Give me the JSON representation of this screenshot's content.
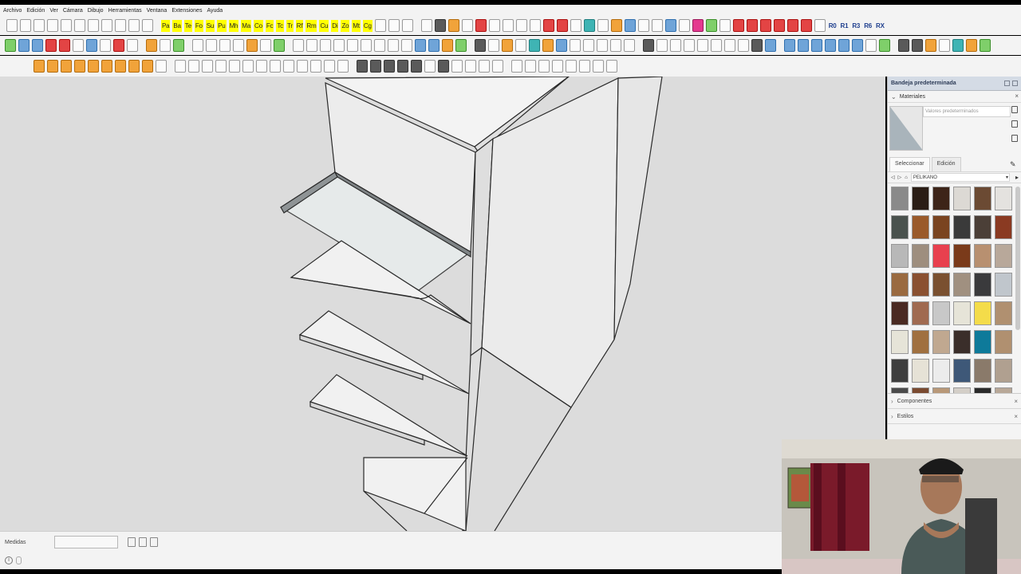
{
  "menubar": {
    "items": [
      "Archivo",
      "Edición",
      "Ver",
      "Cámara",
      "Dibujo",
      "Herramientas",
      "Ventana",
      "Extensiones",
      "Ayuda"
    ]
  },
  "toolbar": {
    "plugin_labels": [
      "Pa",
      "Ba",
      "Te",
      "Fo",
      "Su",
      "Pu",
      "Mh",
      "Ma",
      "Co",
      "Fc",
      "Tc",
      "Tr",
      "Rf",
      "Rm",
      "Cu",
      "Di",
      "Zo",
      "Mt",
      "Cg"
    ],
    "rotation_labels": [
      "R0",
      "R1",
      "R3",
      "R6",
      "RX"
    ]
  },
  "status": {
    "measure_label": "Medidas",
    "measure_value": ""
  },
  "tray": {
    "title": "Bandeja predeterminada",
    "materials_label": "Materiales",
    "material_name_placeholder": "Valores predeterminados",
    "tab_select": "Seleccionar",
    "tab_edit": "Edición",
    "library": "PELIKANO",
    "components_label": "Componentes",
    "styles_label": "Estilos",
    "swatches": [
      "#8a8a8a",
      "#2a1d15",
      "#3d2418",
      "#dcd9d4",
      "#6b4a33",
      "#e4e2df",
      "#4a524e",
      "#9a5a2a",
      "#7a4420",
      "#3a3a3a",
      "#4b3f37",
      "#8a3a22",
      "#b8b8b8",
      "#9e8e7e",
      "#e8404e",
      "#7a3a1a",
      "#b89070",
      "#b8a89a",
      "#9a6a40",
      "#8a5030",
      "#7a5030",
      "#a09080",
      "#3a3a3c",
      "#c0c6cc",
      "#4a2a22",
      "#a06a50",
      "#c8c8c8",
      "#e6e4d8",
      "#f4dc4a",
      "#b09070",
      "#e6e4d8",
      "#a07040",
      "#c0a890",
      "#3a2e2a",
      "#0e7a9a",
      "#b09070",
      "#3e3e3e",
      "#e6e2d6",
      "#ececec",
      "#3e5878",
      "#8a7a6a",
      "#b0a090",
      "#4a4a4a",
      "#7a4a30",
      "#b89878",
      "#d4cfc8",
      "#2a2a2a",
      "#b8a898"
    ]
  }
}
